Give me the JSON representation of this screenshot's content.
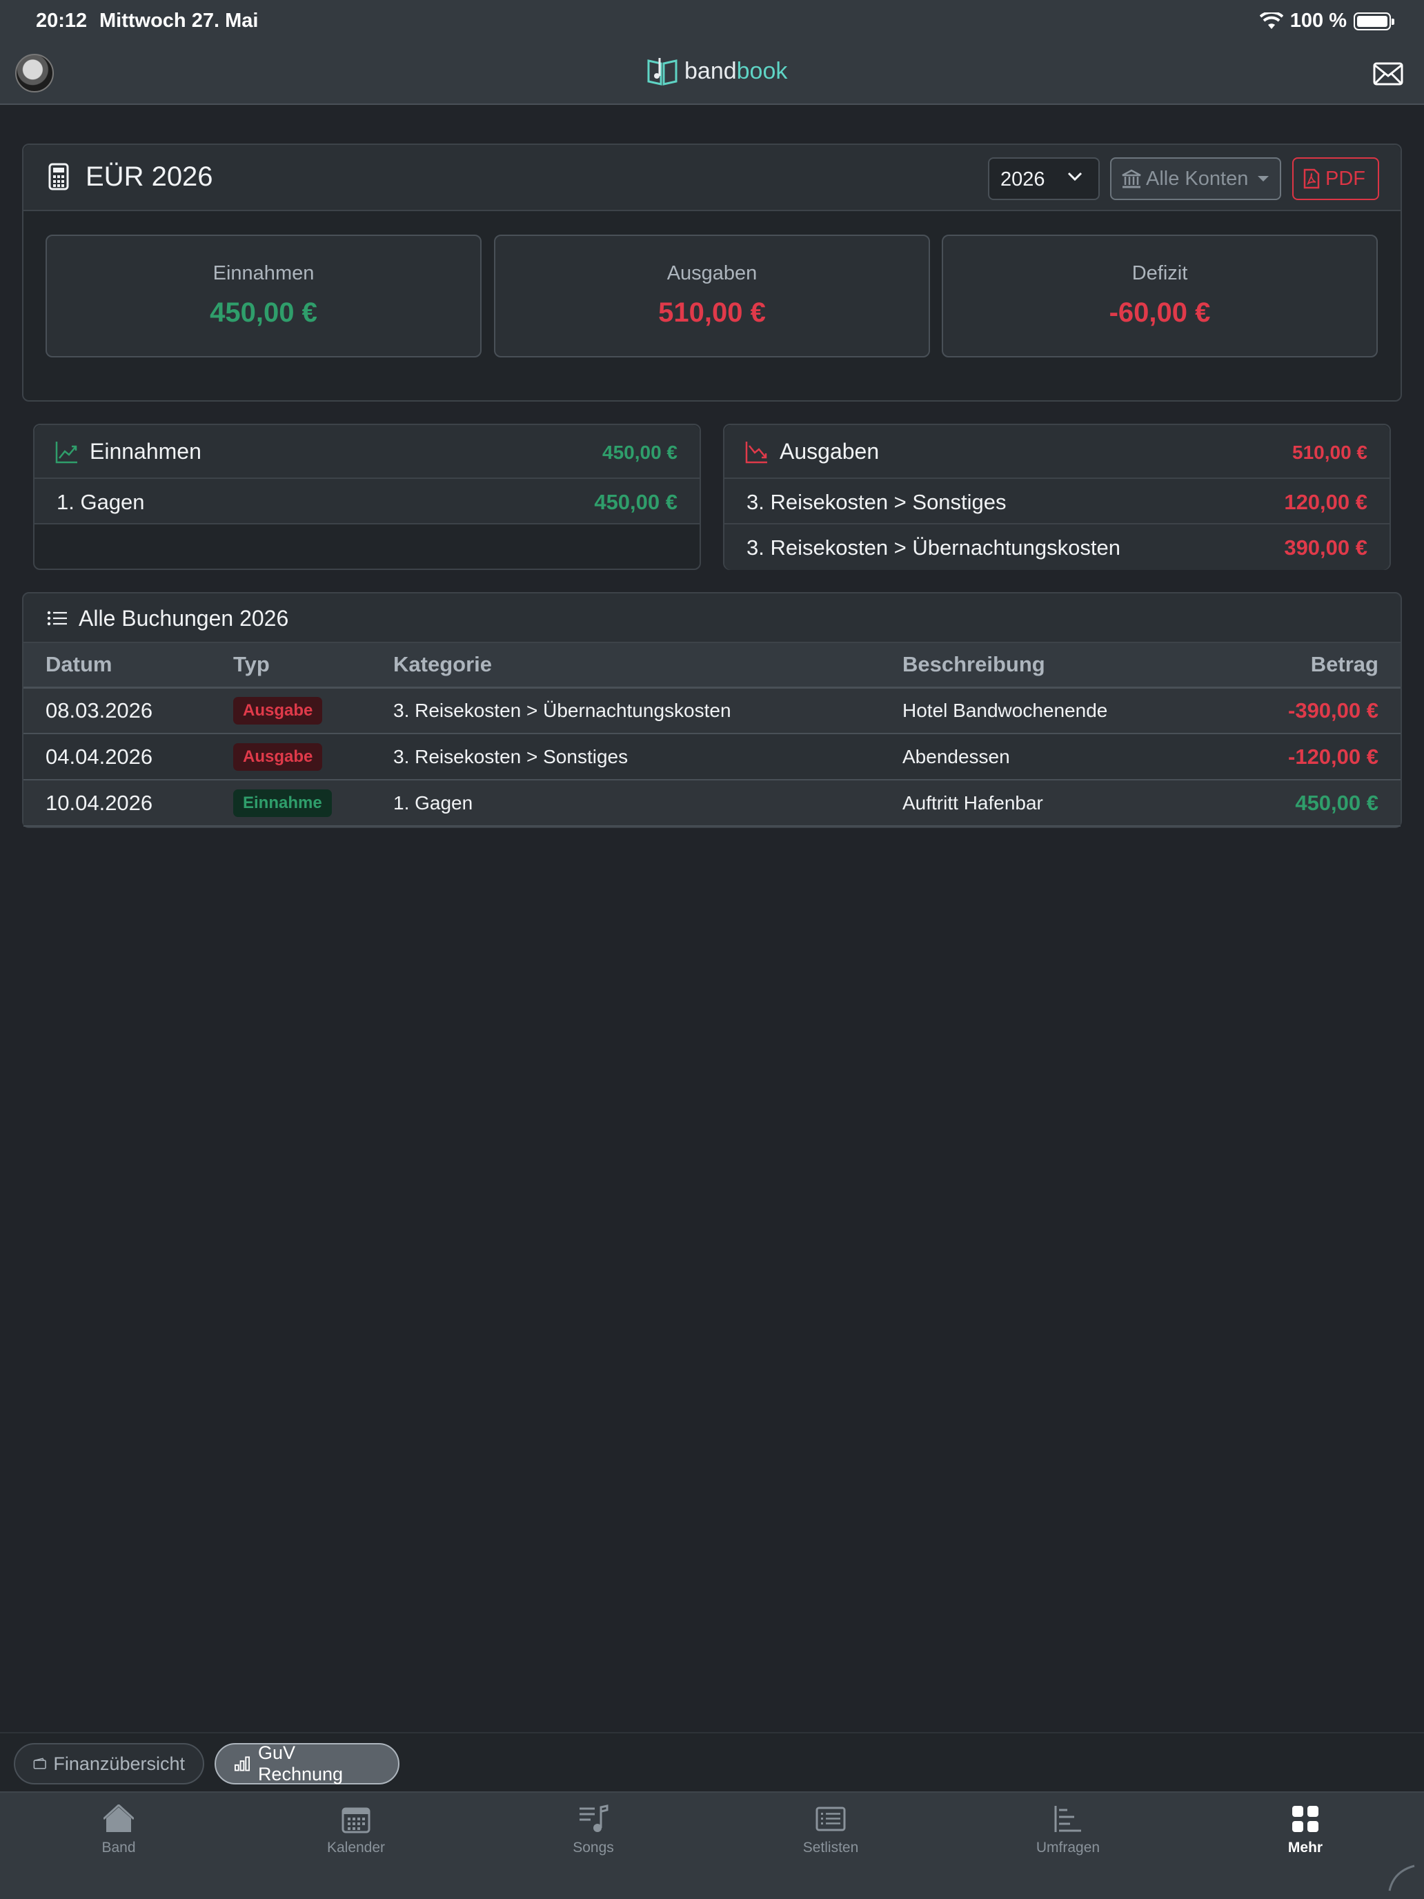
{
  "status_bar": {
    "time": "20:12",
    "date": "Mittwoch 27. Mai",
    "battery": "100 %"
  },
  "app": {
    "brand_part1": "band",
    "brand_part2": "book"
  },
  "report": {
    "title": "EÜR 2026",
    "year_select": "2026",
    "accounts_button": "Alle Konten",
    "pdf_button": "PDF",
    "summary": [
      {
        "label": "Einnahmen",
        "value": "450,00 €"
      },
      {
        "label": "Ausgaben",
        "value": "510,00 €"
      },
      {
        "label": "Defizit",
        "value": "-60,00 €"
      }
    ]
  },
  "income": {
    "title": "Einnahmen",
    "total": "450,00 €",
    "rows": [
      {
        "name": "1. Gagen",
        "amount": "450,00 €"
      }
    ]
  },
  "expenses": {
    "title": "Ausgaben",
    "total": "510,00 €",
    "rows": [
      {
        "name": "3. Reisekosten > Sonstiges",
        "amount": "120,00 €"
      },
      {
        "name": "3. Reisekosten > Übernachtungskosten",
        "amount": "390,00 €"
      }
    ]
  },
  "bookings": {
    "title": "Alle Buchungen 2026",
    "columns": [
      "Datum",
      "Typ",
      "Kategorie",
      "Beschreibung",
      "Betrag"
    ],
    "rows": [
      {
        "date": "08.03.2026",
        "type": "Ausgabe",
        "category": "3. Reisekosten > Übernachtungskosten",
        "description": "Hotel Bandwochenende",
        "amount": "-390,00 €"
      },
      {
        "date": "04.04.2026",
        "type": "Ausgabe",
        "category": "3. Reisekosten > Sonstiges",
        "description": "Abendessen",
        "amount": "-120,00 €"
      },
      {
        "date": "10.04.2026",
        "type": "Einnahme",
        "category": "1. Gagen",
        "description": "Auftritt Hafenbar",
        "amount": "450,00 €"
      }
    ]
  },
  "finance_tabs": [
    {
      "label": "Finanzübersicht"
    },
    {
      "label": "GuV Rechnung"
    }
  ],
  "tabbar": [
    {
      "label": "Band",
      "icon": "house-icon"
    },
    {
      "label": "Kalender",
      "icon": "calendar-icon"
    },
    {
      "label": "Songs",
      "icon": "music-list-icon"
    },
    {
      "label": "Setlisten",
      "icon": "list-icon"
    },
    {
      "label": "Umfragen",
      "icon": "poll-icon"
    },
    {
      "label": "Mehr",
      "icon": "grid-icon"
    }
  ],
  "colors": {
    "income": "#2f9e6b",
    "expense": "#e03a4a",
    "background": "#212429"
  }
}
